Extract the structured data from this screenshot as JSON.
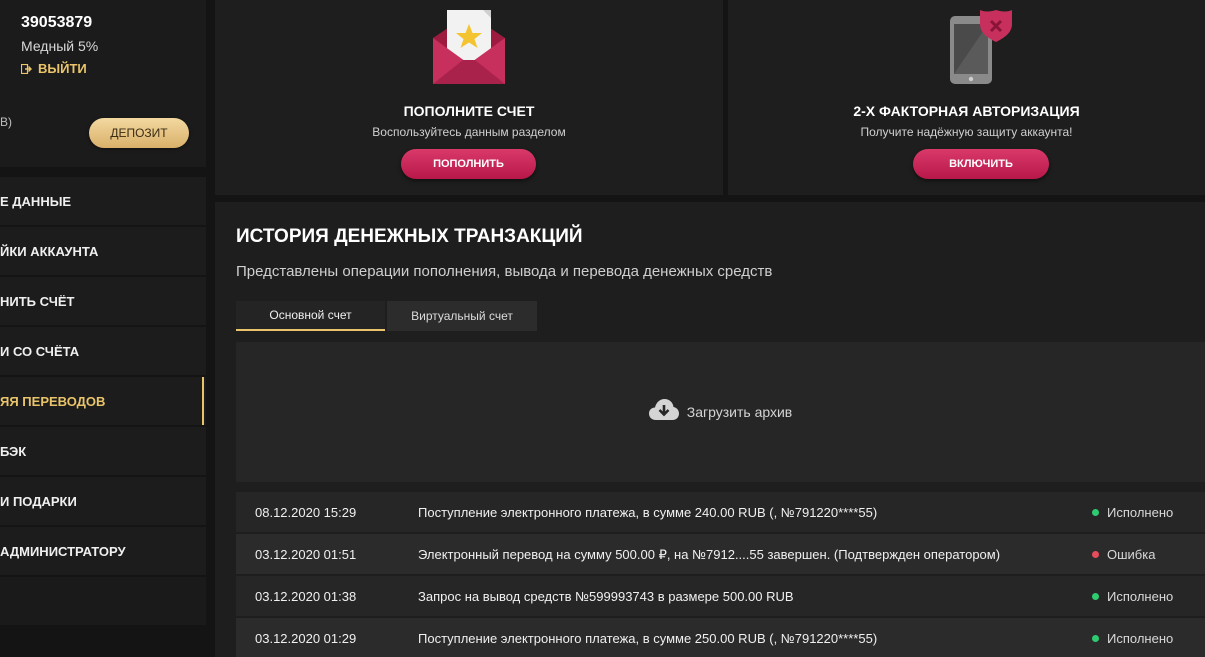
{
  "profile": {
    "user_id": "39053879",
    "level": "Медный 5%",
    "logout_label": "ВЫЙТИ",
    "balance_fragment": "В)",
    "deposit_label": "ДЕПОЗИТ"
  },
  "menu": {
    "items": [
      {
        "label": "Е ДАННЫЕ"
      },
      {
        "label": "ЙКИ АККАУНТА"
      },
      {
        "label": "НИТЬ СЧЁТ"
      },
      {
        "label": "И СО СЧЁТА"
      },
      {
        "label": "ЯЯ ПЕРЕВОДОВ"
      },
      {
        "label": "БЭК"
      },
      {
        "label": "И ПОДАРКИ"
      },
      {
        "label": "АДМИНИСТРАТОРУ"
      },
      {
        "label": ""
      }
    ]
  },
  "promos": [
    {
      "title": "ПОПОЛНИТЕ СЧЕТ",
      "subtitle": "Воспользуйтесь данным разделом",
      "button": "ПОПОЛНИТЬ",
      "icon": "envelope-star-icon"
    },
    {
      "title": "2-Х ФАКТОРНАЯ АВТОРИЗАЦИЯ",
      "subtitle": "Получите надёжную защиту аккаунта!",
      "button": "ВКЛЮЧИТЬ",
      "icon": "phone-shield-icon"
    }
  ],
  "history": {
    "title": "ИСТОРИЯ ДЕНЕЖНЫХ ТРАНЗАКЦИЙ",
    "subtitle": "Представлены операции пополнения, вывода и перевода денежных средств",
    "tabs": [
      {
        "label": "Основной счет",
        "active": true
      },
      {
        "label": "Виртуальный счет",
        "active": false
      }
    ],
    "archive_label": "Загрузить архив",
    "transactions": [
      {
        "date": "08.12.2020 15:29",
        "description": "Поступление электронного платежа, в сумме 240.00 RUB (, №791220****55)",
        "status": "Исполнено",
        "status_color": "#2ecc71"
      },
      {
        "date": "03.12.2020 01:51",
        "description": "Электронный перевод на сумму 500.00 ₽, на №7912....55 завершен. (Подтвержден оператором)",
        "status": "Ошибка",
        "status_color": "#e74c5c"
      },
      {
        "date": "03.12.2020 01:38",
        "description": "Запрос на вывод средств №599993743 в размере 500.00 RUB",
        "status": "Исполнено",
        "status_color": "#2ecc71"
      },
      {
        "date": "03.12.2020 01:29",
        "description": "Поступление электронного платежа, в сумме 250.00 RUB (, №791220****55)",
        "status": "Исполнено",
        "status_color": "#2ecc71"
      }
    ]
  },
  "colors": {
    "accent_gold": "#e9c46a",
    "accent_pink": "#c9245a",
    "panel": "#1e1e1e",
    "background": "#141414"
  }
}
